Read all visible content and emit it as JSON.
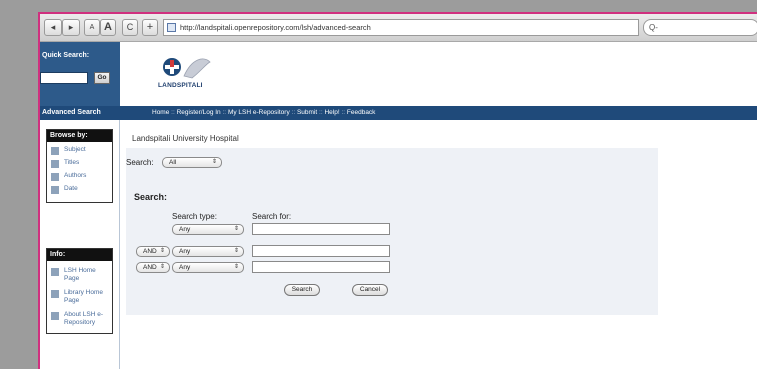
{
  "browser": {
    "back": "◂",
    "forward": "▸",
    "text_size_small": "A",
    "text_size_large": "A",
    "reload": "C",
    "add": "+",
    "url": "http://landspitali.openrepository.com/lsh/advanced-search",
    "search_placeholder": "Q-"
  },
  "header": {
    "quick_search_label": "Quick Search:",
    "go_label": "Go",
    "logo_text": "LANDSPITALI"
  },
  "nav": {
    "left_label": "Advanced Search",
    "items": [
      "Home",
      "Register/Log In",
      "My LSH e-Repository",
      "Submit",
      "Help!",
      "Feedback"
    ],
    "separator": "::"
  },
  "sidebar": {
    "browse_title": "Browse by:",
    "browse_items": [
      "Subject",
      "Titles",
      "Authors",
      "Date"
    ],
    "info_title": "Info:",
    "info_items": [
      "LSH Home Page",
      "Library Home Page",
      "About LSH e-Repository"
    ]
  },
  "main": {
    "hospital_name": "Landspitali University Hospital",
    "scope_label": "Search:",
    "scope_value": "All",
    "search_heading": "Search:",
    "search_type_header": "Search type:",
    "search_for_header": "Search for:",
    "row1_type": "Any",
    "row2_op": "AND",
    "row2_type": "Any",
    "row3_op": "AND",
    "row3_type": "Any",
    "search_button": "Search",
    "cancel_button": "Cancel"
  }
}
